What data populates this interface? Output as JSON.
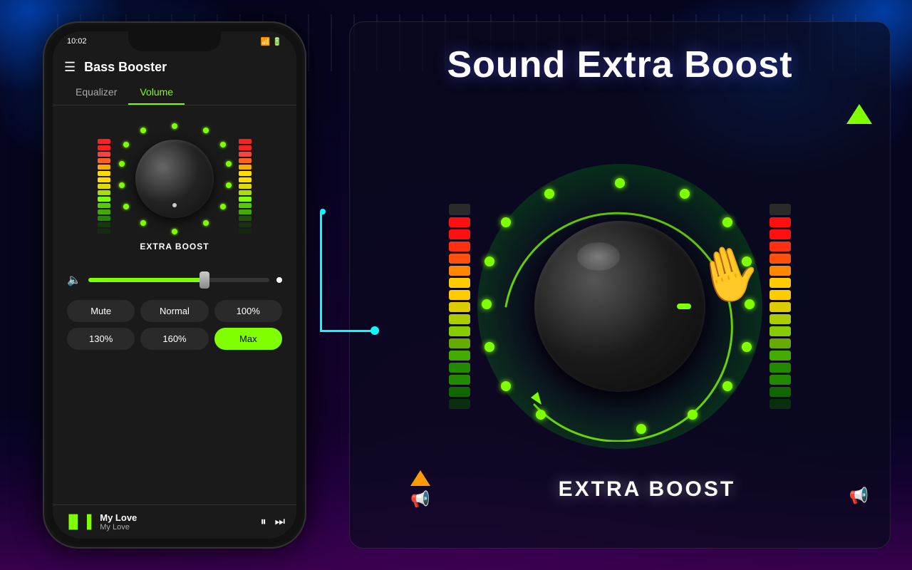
{
  "app": {
    "title": "Bass Booster",
    "status_time": "10:02",
    "status_icons": "WiFi 100"
  },
  "tabs": {
    "equalizer": "Equalizer",
    "volume": "Volume",
    "active": "volume"
  },
  "knob": {
    "label": "EXTRA BOOST"
  },
  "presets": [
    {
      "label": "Mute",
      "active": false
    },
    {
      "label": "Normal",
      "active": false
    },
    {
      "label": "100%",
      "active": false
    },
    {
      "label": "130%",
      "active": false
    },
    {
      "label": "160%",
      "active": false
    },
    {
      "label": "Max",
      "active": true
    }
  ],
  "player": {
    "title": "My Love",
    "subtitle": "My Love"
  },
  "headline": {
    "line1": "Sound Extra Boost"
  },
  "boost": {
    "label": "EXTRA BOOST"
  },
  "vu_colors": {
    "red": "#ff2020",
    "yellow": "#ffdd00",
    "green": "#00dd00",
    "bright_green": "#7fff00"
  }
}
